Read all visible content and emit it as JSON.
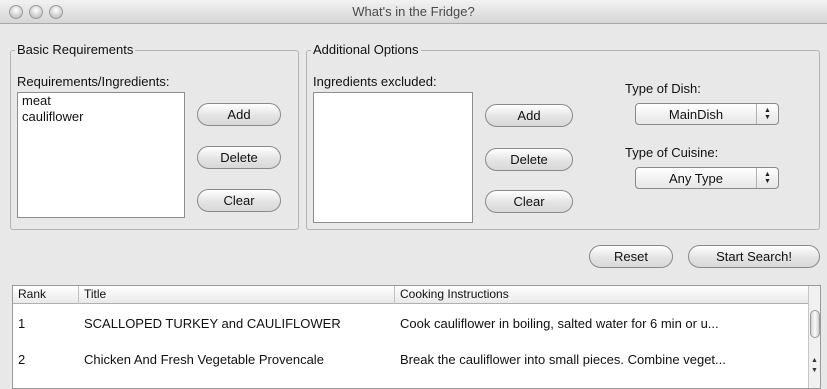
{
  "window": {
    "title": "What's in the Fridge?"
  },
  "basic": {
    "legend": "Basic Requirements",
    "list_label": "Requirements/Ingredients:",
    "items": [
      "meat",
      "cauliflower"
    ],
    "add_label": "Add",
    "delete_label": "Delete",
    "clear_label": "Clear"
  },
  "additional": {
    "legend": "Additional Options",
    "list_label": "Ingredients excluded:",
    "items": [],
    "add_label": "Add",
    "delete_label": "Delete",
    "clear_label": "Clear",
    "dish_label": "Type of Dish:",
    "dish_value": "MainDish",
    "cuisine_label": "Type of Cuisine:",
    "cuisine_value": "Any Type"
  },
  "actions": {
    "reset_label": "Reset",
    "search_label": "Start Search!"
  },
  "table": {
    "headers": [
      "Rank",
      "Title",
      "Cooking Instructions"
    ],
    "rows": [
      [
        "1",
        "SCALLOPED TURKEY and CAULIFLOWER",
        "Cook cauliflower in boiling, salted water for 6 min or u..."
      ],
      [
        "2",
        "Chicken And Fresh Vegetable Provencale",
        "Break the cauliflower into small pieces. Combine veget..."
      ]
    ]
  }
}
